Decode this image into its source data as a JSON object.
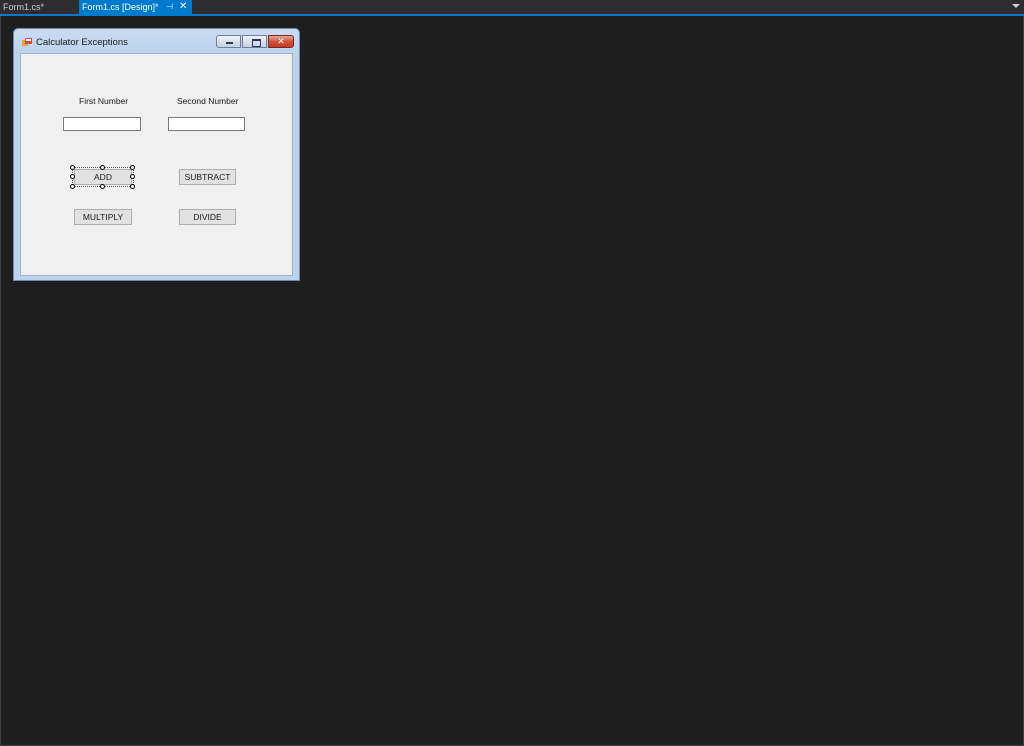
{
  "tabs": [
    {
      "label": "Form1.cs*"
    },
    {
      "label": "Form1.cs [Design]*",
      "pin_icon": "pin-icon",
      "close_icon": "close-icon"
    }
  ],
  "form": {
    "title": "Calculator Exceptions",
    "icon": "form-app-icon",
    "first_label": "First Number",
    "second_label": "Second Number",
    "first_value": "",
    "second_value": "",
    "buttons": {
      "add": "ADD",
      "subtract": "SUBTRACT",
      "multiply": "MULTIPLY",
      "divide": "DIVIDE"
    },
    "selected_control": "ADD"
  },
  "colors": {
    "accent": "#007acc",
    "background": "#1e1e1e",
    "close_button": "#c23a26"
  }
}
